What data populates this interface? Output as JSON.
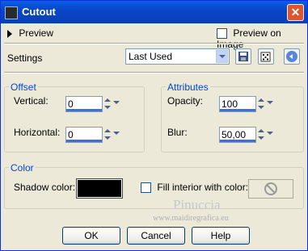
{
  "window": {
    "title": "Cutout",
    "close_glyph": "✕"
  },
  "preview": {
    "label": "Preview",
    "preview_on_image_label": "Preview on Image",
    "preview_on_image_checked": false
  },
  "settings": {
    "label": "Settings",
    "value": "Last Used",
    "icons": [
      "save-icon",
      "dice-icon",
      "reset-icon"
    ]
  },
  "offset": {
    "title": "Offset",
    "vertical_label": "Vertical:",
    "vertical_value": "0",
    "horizontal_label": "Horizontal:",
    "horizontal_value": "0"
  },
  "attributes": {
    "title": "Attributes",
    "opacity_label": "Opacity:",
    "opacity_value": "100",
    "blur_label": "Blur:",
    "blur_value": "50,00"
  },
  "color": {
    "title": "Color",
    "shadow_label": "Shadow color:",
    "shadow_value": "#000000",
    "fill_label": "Fill interior with color:",
    "fill_checked": false
  },
  "buttons": {
    "ok": "OK",
    "cancel": "Cancel",
    "help": "Help"
  },
  "watermark": {
    "name": "Pinuccia",
    "site": "www.maidiregrafica.eu"
  },
  "colors": {
    "titlebar": "#0a46c8",
    "group_title": "#0046d5",
    "background": "#ece9d8"
  }
}
